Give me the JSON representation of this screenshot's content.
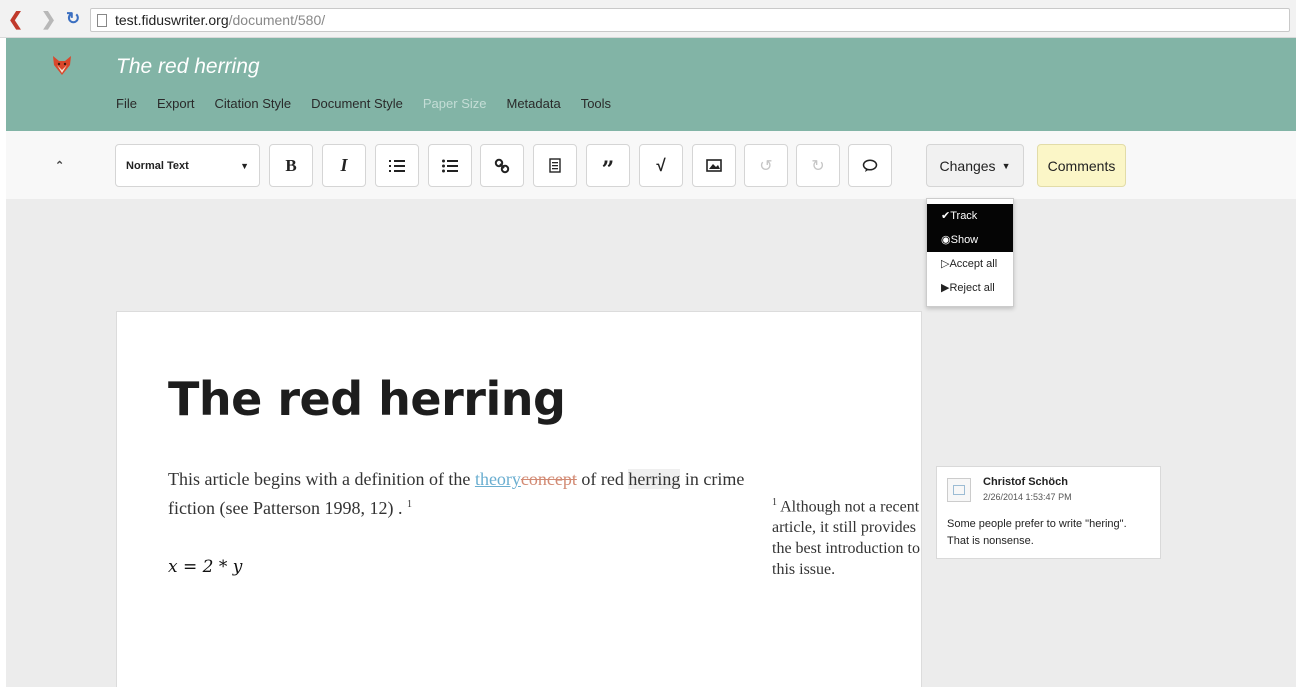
{
  "browser": {
    "url_host": "test.fiduswriter.org",
    "url_path": "/document/580/"
  },
  "header": {
    "title": "The red herring",
    "menu": [
      "File",
      "Export",
      "Citation Style",
      "Document Style",
      "Paper Size",
      "Metadata",
      "Tools"
    ]
  },
  "toolbar": {
    "style_select": "Normal Text",
    "bold": "B",
    "italic": "I",
    "changes_label": "Changes",
    "comments_label": "Comments"
  },
  "changes_menu": [
    {
      "label": "Track",
      "icon": "check-icon",
      "active": true
    },
    {
      "label": "Show",
      "icon": "eye-icon",
      "active": true
    },
    {
      "label": "Accept all",
      "icon": "accept-icon",
      "active": false
    },
    {
      "label": "Reject all",
      "icon": "reject-icon",
      "active": false
    }
  ],
  "document": {
    "title": "The red herring",
    "body_pre": "This article begins with a definition of the ",
    "inserted": "theory",
    "deleted": "concept",
    "body_mid": " of red ",
    "highlighted": "herring",
    "body_post": " in crime fiction (see Patterson 1998, 12) . ",
    "footnote_mark": "1",
    "formula": "x = 2 * y",
    "footnote_number": "1",
    "footnote_text": "Although not a recent article, it still provides the best introduction to this issue."
  },
  "comment": {
    "author": "Christof Schöch",
    "date": "2/26/2014 1:53:47 PM",
    "text": "Some people prefer to write \"hering\". That is nonsense."
  },
  "colors": {
    "header_bg": "#82b4a6",
    "comments_btn_bg": "#fbf6c7",
    "inserted_text": "#6aaed0",
    "deleted_text": "#d28a73"
  }
}
